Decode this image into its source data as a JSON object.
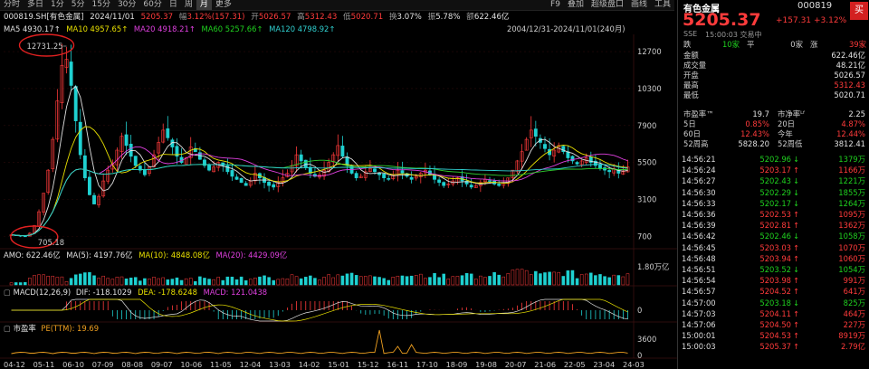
{
  "toolbar": {
    "left": [
      "分时",
      "多日",
      "1分",
      "5分",
      "15分",
      "30分",
      "60分",
      "日",
      "周",
      "月",
      "更多"
    ],
    "active_index": 9,
    "right": [
      "F9",
      "叠加",
      "超级盘口",
      "画线",
      "工具"
    ]
  },
  "quote": {
    "name": "000819.SH[有色金属]",
    "date": "2024/11/01",
    "price": "5205.37",
    "change_label": "幅",
    "change": "3.12%(157.31)",
    "open_label": "开",
    "open": "5026.57",
    "high_label": "高",
    "high": "5312.43",
    "low_label": "低",
    "low": "5020.71",
    "turnover_label": "换",
    "turnover": "3.07%",
    "amplitude_label": "振",
    "amplitude": "5.78%",
    "amount_label": "额",
    "amount": "622.46亿"
  },
  "ma": {
    "ma5": "MA5 4930.17↑",
    "ma10": "MA10 4957.65↑",
    "ma20": "MA20 4918.21↑",
    "ma60": "MA60 5257.66↑",
    "ma120": "MA120 4798.92↑",
    "range": "2004/12/31-2024/11/01(240月)"
  },
  "sub": {
    "amo": "AMO: 622.46亿",
    "ma5": "MA(5): 4197.76亿",
    "ma10": "MA(10): 4848.08亿",
    "ma20": "MA(20): 4429.09亿",
    "macd_name": "MACD(12,26,9)",
    "dif": "DIF: -118.1029",
    "dea": "DEA: -178.6248",
    "macd": "MACD: 121.0438",
    "pe_name": "市盈率",
    "pe": "PE(TTM): 19.69"
  },
  "colors": {
    "up": "#ff3b3b",
    "down": "#1fd11f",
    "ma5": "#e0e0e0",
    "ma10": "#e8e000",
    "ma20": "#e040e0",
    "ma60": "#30d030",
    "ma120": "#30d0d0"
  },
  "chart_data": {
    "type": "candlestick",
    "y_ticks": [
      700,
      3100,
      5500,
      7900,
      10300,
      12700
    ],
    "ylim": [
      -100,
      13700
    ],
    "x_tick_labels": [
      "04-12",
      "05-11",
      "06-10",
      "07-09",
      "08-08",
      "09-07",
      "10-06",
      "11-05",
      "12-04",
      "13-03",
      "14-02",
      "15-01",
      "15-12",
      "16-11",
      "17-10",
      "18-09",
      "19-08",
      "20-07",
      "21-06",
      "22-05",
      "23-04",
      "24-03"
    ],
    "annotations": {
      "high": "12731.25",
      "low": "705.18"
    },
    "close_path": [
      800,
      760,
      720,
      705,
      900,
      1400,
      2300,
      3500,
      5000,
      7000,
      9500,
      11800,
      12200,
      10500,
      8200,
      6000,
      4500,
      3400,
      2800,
      3300,
      4300,
      5000,
      5400,
      6300,
      7200,
      6600,
      5900,
      5300,
      5000,
      4700,
      5200,
      6000,
      6800,
      7600,
      7100,
      6500,
      5900,
      5500,
      5800,
      6500,
      6200,
      5700,
      5300,
      5000,
      5200,
      5500,
      5300,
      4900,
      4600,
      4400,
      4200,
      4000,
      4300,
      4800,
      4500,
      4200,
      4000,
      3900,
      4200,
      4500,
      4800,
      5300,
      6000,
      5600,
      5200,
      4800,
      4600,
      4700,
      5000,
      5500,
      6000,
      6600,
      5900,
      5300,
      4800,
      4500,
      4600,
      4900,
      5100,
      4900,
      4700,
      4500,
      4400,
      4700,
      5000,
      4800,
      4600,
      4400,
      4600,
      4800,
      5000,
      4700,
      4400,
      4200,
      4000,
      4100,
      4300,
      4500,
      4300,
      4100,
      3900,
      4000,
      4200,
      4400,
      4300,
      4100,
      4000,
      4200,
      4500,
      5000,
      5600,
      6200,
      7000,
      7600,
      7200,
      6800,
      6400,
      6000,
      6300,
      6600,
      6200,
      5800,
      5600,
      5400,
      5600,
      5800,
      5500,
      5300,
      5100,
      5000,
      4900,
      5100,
      4800,
      4900,
      5205
    ],
    "amo_label": "1.80万亿",
    "pe_ticks": [
      "3600",
      "0"
    ]
  },
  "right": {
    "name": "有色金属",
    "code": "000819",
    "price": "5205.37",
    "chg": "+157.31",
    "pct": "+3.12%",
    "buy": "买",
    "exch": "SSE",
    "time_status": "15:00:03 交易中",
    "breadth": [
      [
        "跌",
        "10家"
      ],
      [
        "平",
        "0家"
      ],
      [
        "涨",
        "39家"
      ]
    ],
    "stats": [
      [
        "金额",
        "622.46亿",
        "w"
      ],
      [
        "成交量",
        "48.21亿",
        "w"
      ],
      [
        "开盘",
        "5026.57",
        "w"
      ],
      [
        "最高",
        "5312.43",
        "r"
      ],
      [
        "最低",
        "5020.71",
        "w"
      ]
    ],
    "val": [
      [
        "市盈率™",
        "19.7",
        "市净率ᴸᶠ",
        "2.25"
      ],
      [
        "5日",
        "0.85%",
        "20日",
        "4.87%"
      ],
      [
        "60日",
        "12.43%",
        "今年",
        "12.44%"
      ],
      [
        "52周高",
        "5828.20",
        "52周低",
        "3812.41"
      ]
    ],
    "ticks": [
      [
        "14:56:21",
        "5202.96",
        "↓",
        "1379万",
        "d"
      ],
      [
        "14:56:24",
        "5203.17",
        "↑",
        "1166万",
        "u"
      ],
      [
        "14:56:27",
        "5202.43",
        "↓",
        "1221万",
        "d"
      ],
      [
        "14:56:30",
        "5202.29",
        "↓",
        "1855万",
        "d"
      ],
      [
        "14:56:33",
        "5202.17",
        "↓",
        "1264万",
        "d"
      ],
      [
        "14:56:36",
        "5202.53",
        "↑",
        "1095万",
        "u"
      ],
      [
        "14:56:39",
        "5202.81",
        "↑",
        "1362万",
        "u"
      ],
      [
        "14:56:42",
        "5202.46",
        "↓",
        "1058万",
        "d"
      ],
      [
        "14:56:45",
        "5203.03",
        "↑",
        "1070万",
        "u"
      ],
      [
        "14:56:48",
        "5203.94",
        "↑",
        "1060万",
        "u"
      ],
      [
        "14:56:51",
        "5203.52",
        "↓",
        "1054万",
        "d"
      ],
      [
        "14:56:54",
        "5203.98",
        "↑",
        "991万",
        "u"
      ],
      [
        "14:56:57",
        "5204.52",
        "↑",
        "641万",
        "u"
      ],
      [
        "14:57:00",
        "5203.18",
        "↓",
        "825万",
        "d"
      ],
      [
        "14:57:03",
        "5204.11",
        "↑",
        "464万",
        "u"
      ],
      [
        "14:57:06",
        "5204.50",
        "↑",
        "227万",
        "u"
      ],
      [
        "15:00:01",
        "5204.53",
        "↑",
        "8919万",
        "u"
      ],
      [
        "15:00:03",
        "5205.37",
        "↑",
        "2.79亿",
        "u"
      ]
    ]
  }
}
